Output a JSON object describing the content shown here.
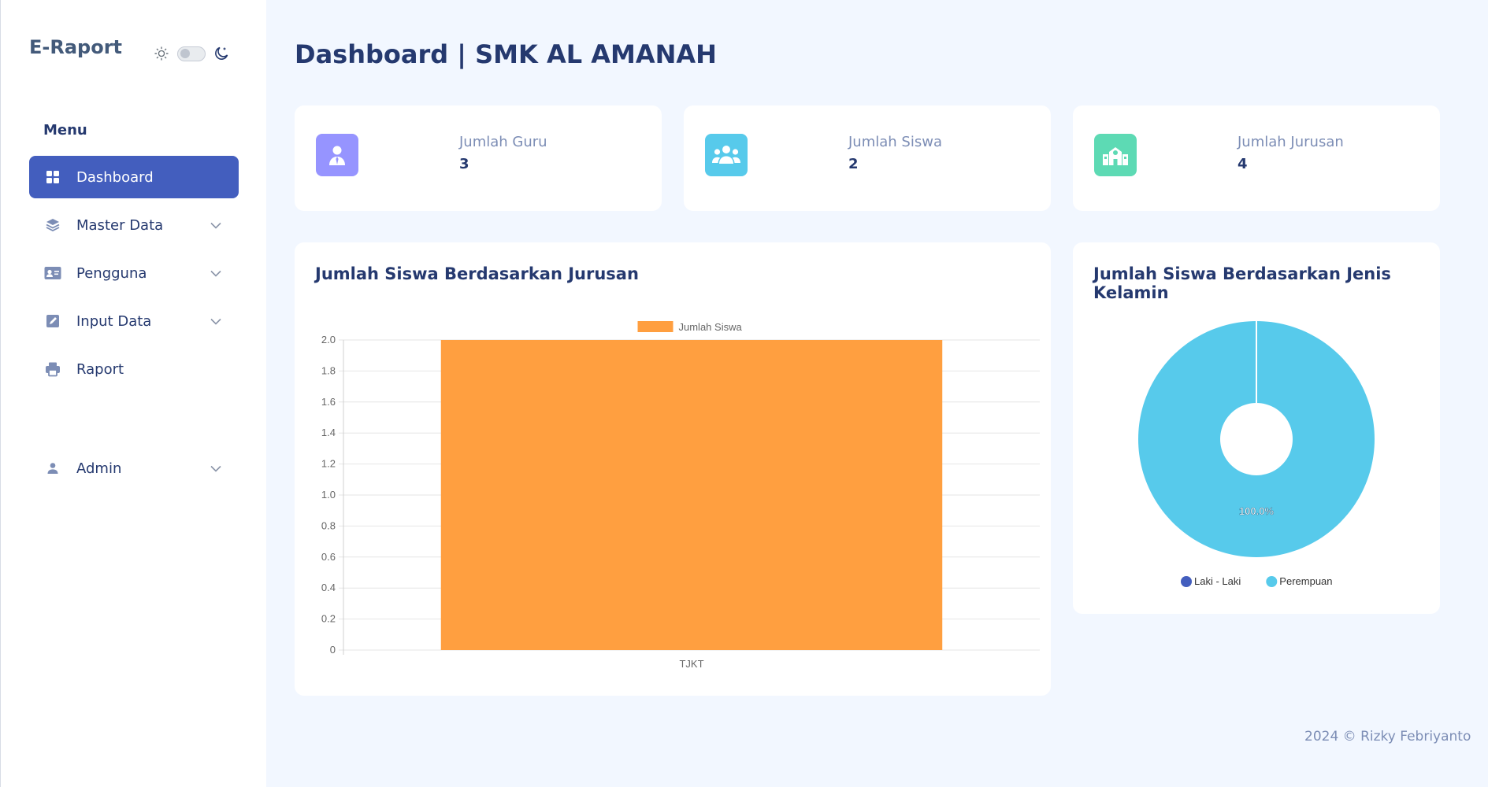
{
  "sidebar": {
    "logo": "E-Raport",
    "menu_title": "Menu",
    "items": [
      {
        "label": "Dashboard",
        "icon": "grid-icon",
        "active": true
      },
      {
        "label": "Master Data",
        "icon": "stack-icon",
        "has_submenu": true
      },
      {
        "label": "Pengguna",
        "icon": "person-vcard-icon",
        "has_submenu": true
      },
      {
        "label": "Input Data",
        "icon": "pencil-square-icon",
        "has_submenu": true
      },
      {
        "label": "Raport",
        "icon": "printer-icon"
      },
      {
        "label": "Admin",
        "icon": "person-icon",
        "has_submenu": true
      }
    ]
  },
  "header": {
    "title": "Dashboard | SMK AL AMANAH"
  },
  "stats": [
    {
      "label": "Jumlah Guru",
      "value": "3",
      "icon": "teacher-icon",
      "color": "#9694ff"
    },
    {
      "label": "Jumlah Siswa",
      "value": "2",
      "icon": "people-icon",
      "color": "#57caeb"
    },
    {
      "label": "Jumlah Jurusan",
      "value": "4",
      "icon": "school-icon",
      "color": "#5ddab4"
    }
  ],
  "footer": "2024 © Rizky Febriyanto",
  "chart_data": [
    {
      "type": "bar",
      "title": "Jumlah Siswa Berdasarkan Jurusan",
      "categories": [
        "TJKT"
      ],
      "series": [
        {
          "name": "Jumlah Siswa",
          "values": [
            2
          ],
          "color": "#ff9f40"
        }
      ],
      "ylim": [
        0,
        2.0
      ],
      "yticks": [
        "0",
        "0.2",
        "0.4",
        "0.6",
        "0.8",
        "1.0",
        "1.2",
        "1.4",
        "1.6",
        "1.8",
        "2.0"
      ],
      "legend": "top",
      "grid": true
    },
    {
      "type": "pie",
      "title": "Jumlah Siswa Berdasarkan Jenis Kelamin",
      "labels": [
        "Laki - Laki",
        "Perempuan"
      ],
      "values": [
        0,
        100
      ],
      "colors": [
        "#435ebe",
        "#57caeb"
      ],
      "data_label": "100.0%",
      "legend": "bottom"
    }
  ]
}
